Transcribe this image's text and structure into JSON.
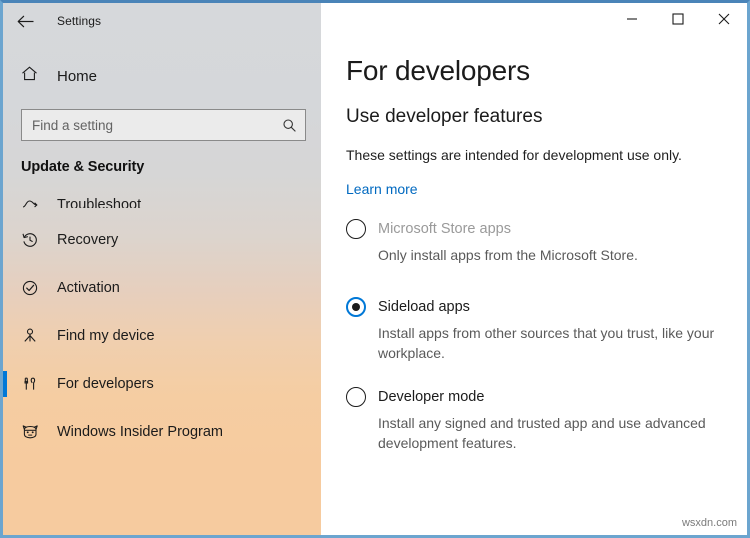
{
  "window": {
    "app_title": "Settings",
    "back_icon": "back-arrow-icon",
    "controls": {
      "minimize": "minimize-icon",
      "maximize": "maximize-icon",
      "close": "close-icon"
    },
    "border_color": "#6ca5cf",
    "accent_color": "#0078d7"
  },
  "sidebar": {
    "home": {
      "label": "Home",
      "icon": "home-icon"
    },
    "search": {
      "placeholder": "Find a setting",
      "value": "",
      "icon": "search-icon"
    },
    "section_header": "Update & Security",
    "items": [
      {
        "label": "Troubleshoot",
        "icon": "troubleshoot-icon",
        "selected": false,
        "clipped": true
      },
      {
        "label": "Recovery",
        "icon": "recovery-history-icon",
        "selected": false,
        "clipped": false
      },
      {
        "label": "Activation",
        "icon": "activation-check-icon",
        "selected": false,
        "clipped": false
      },
      {
        "label": "Find my device",
        "icon": "find-my-device-icon",
        "selected": false,
        "clipped": false
      },
      {
        "label": "For developers",
        "icon": "developer-tools-icon",
        "selected": true,
        "clipped": false
      },
      {
        "label": "Windows Insider Program",
        "icon": "ninja-cat-icon",
        "selected": false,
        "clipped": false
      }
    ]
  },
  "main": {
    "page_title": "For developers",
    "section_title": "Use developer features",
    "intro_text": "These settings are intended for development use only.",
    "learn_more": "Learn more",
    "options": [
      {
        "label": "Microsoft Store apps",
        "description": "Only install apps from the Microsoft Store.",
        "selected": false,
        "disabled": true
      },
      {
        "label": "Sideload apps",
        "description": "Install apps from other sources that you trust, like your workplace.",
        "selected": true,
        "disabled": false
      },
      {
        "label": "Developer mode",
        "description": "Install any signed and trusted app and use advanced development features.",
        "selected": false,
        "disabled": false
      }
    ]
  },
  "watermark": "wsxdn.com"
}
